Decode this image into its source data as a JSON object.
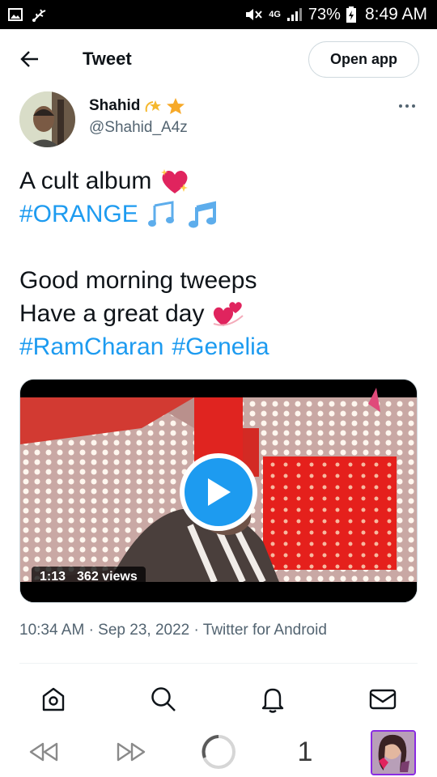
{
  "status_bar": {
    "battery": "73%",
    "network": "4G",
    "time": "8:49 AM"
  },
  "header": {
    "title": "Tweet",
    "open_app_label": "Open app"
  },
  "author": {
    "name": "Shahid",
    "name_emojis": [
      "dizzy-star-emoji",
      "star-emoji"
    ],
    "handle": "@Shahid_A4z"
  },
  "tweet": {
    "line1": "A cult album",
    "line2_tag": "#ORANGE",
    "line3": "Good morning tweeps",
    "line4": "Have a great day",
    "tag1": "#RamCharan",
    "tag2": "#Genelia"
  },
  "video": {
    "duration": "1:13",
    "views": "362 views"
  },
  "meta": {
    "time": "10:34 AM",
    "date": "Sep 23, 2022",
    "source": "Twitter for Android",
    "separator": "·"
  },
  "browser": {
    "tab_count": "1"
  },
  "colors": {
    "accent": "#1d9bf0",
    "text": "#0f1419",
    "secondary": "#536471"
  }
}
